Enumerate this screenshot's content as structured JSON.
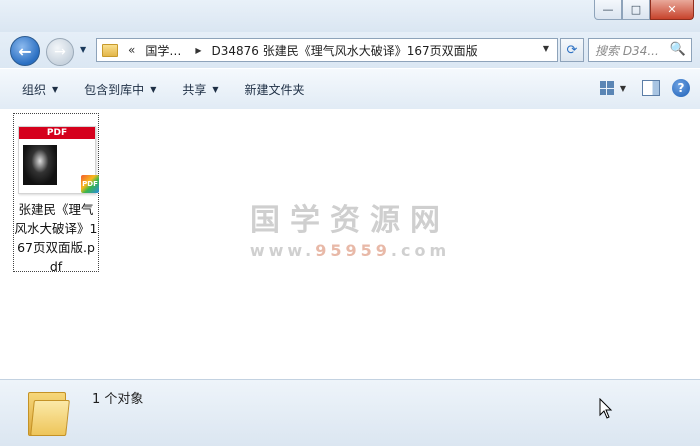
{
  "window": {
    "controls": {
      "minimize": "—",
      "maximize": "□",
      "close": "✕"
    }
  },
  "nav": {
    "back_glyph": "←",
    "forward_glyph": "→",
    "history_dropdown": "▼"
  },
  "address": {
    "overflow_chevron": "«",
    "crumbs": [
      "国学…",
      "D34876 张建民《理气风水大破译》167页双面版"
    ],
    "separator": "▶",
    "dropdown": "▼"
  },
  "refresh_glyph": "⟳",
  "search": {
    "placeholder": "搜索 D34...",
    "icon": "🔍"
  },
  "toolbar": {
    "organize": "组织",
    "include_in_library": "包含到库中",
    "share": "共享",
    "new_folder": "新建文件夹",
    "dropdown_glyph": "▼",
    "help_glyph": "?"
  },
  "file": {
    "pdf_band_label": "PDF",
    "badge_label": "PDF",
    "name": "张建民《理气风水大破译》167页双面版.pdf"
  },
  "watermark": {
    "line1": "国学资源网",
    "line2_prefix": "www.",
    "line2_accent": "95959",
    "line2_suffix": ".com"
  },
  "status": {
    "text": "1 个对象"
  }
}
